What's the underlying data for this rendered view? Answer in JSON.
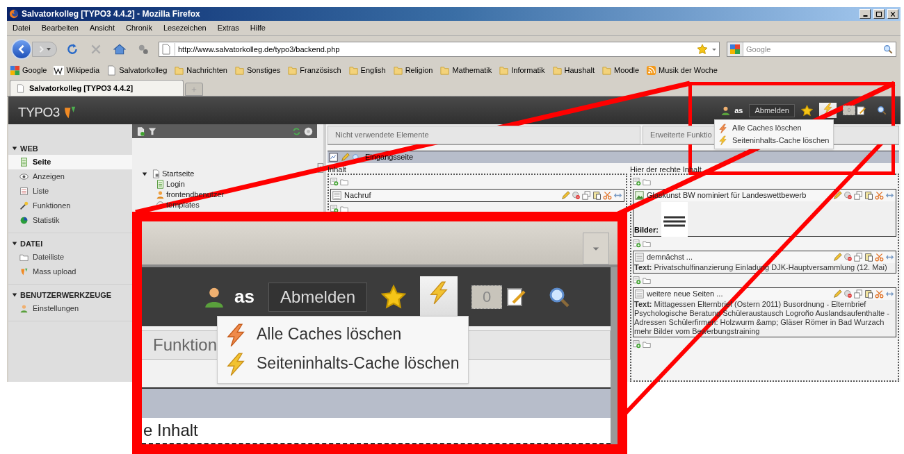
{
  "browser": {
    "title": "Salvatorkolleg [TYPO3 4.4.2] - Mozilla Firefox",
    "menu": [
      "Datei",
      "Bearbeiten",
      "Ansicht",
      "Chronik",
      "Lesezeichen",
      "Extras",
      "Hilfe"
    ],
    "url": "http://www.salvatorkolleg.de/typo3/backend.php",
    "search_placeholder": "Google",
    "bookmarks": [
      {
        "label": "Google",
        "kind": "google"
      },
      {
        "label": "Wikipedia",
        "kind": "wiki"
      },
      {
        "label": "Salvatorkolleg",
        "kind": "page"
      },
      {
        "label": "Nachrichten",
        "kind": "folder"
      },
      {
        "label": "Sonstiges",
        "kind": "folder"
      },
      {
        "label": "Französisch",
        "kind": "folder"
      },
      {
        "label": "English",
        "kind": "folder"
      },
      {
        "label": "Religion",
        "kind": "folder"
      },
      {
        "label": "Mathematik",
        "kind": "folder"
      },
      {
        "label": "Informatik",
        "kind": "folder"
      },
      {
        "label": "Haushalt",
        "kind": "folder"
      },
      {
        "label": "Moodle",
        "kind": "folder"
      },
      {
        "label": "Musik der Woche",
        "kind": "rss"
      }
    ],
    "tabs": [
      {
        "label": "Salvatorkolleg [TYPO3 4.4.2]",
        "selected": true
      }
    ]
  },
  "backend": {
    "logo": "TYPO3",
    "user": "as",
    "logout": "Abmelden",
    "badge": "0",
    "cache_menu_open": true,
    "cache_menu": [
      {
        "label": "Alle Caches löschen",
        "kind": "all"
      },
      {
        "label": "Seiteninhalts-Cache löschen",
        "kind": "page"
      }
    ],
    "modules": [
      {
        "heading": "WEB",
        "expanded": true,
        "items": [
          {
            "label": "Seite",
            "kind": "page",
            "selected": true
          },
          {
            "label": "Anzeigen",
            "kind": "eye",
            "selected": false
          },
          {
            "label": "Liste",
            "kind": "list",
            "selected": false
          },
          {
            "label": "Funktionen",
            "kind": "wand",
            "selected": false
          },
          {
            "label": "Statistik",
            "kind": "pie",
            "selected": false
          }
        ]
      },
      {
        "heading": "DATEI",
        "expanded": true,
        "items": [
          {
            "label": "Dateiliste",
            "kind": "folder",
            "selected": false
          },
          {
            "label": "Mass upload",
            "kind": "logo",
            "selected": false
          }
        ]
      },
      {
        "heading": "BENUTZERWERKZEUGE",
        "expanded": true,
        "items": [
          {
            "label": "Einstellungen",
            "kind": "user",
            "selected": false
          }
        ]
      }
    ],
    "page_tree": [
      {
        "label": "Startseite",
        "expanded": true,
        "kind": "root",
        "children": [
          {
            "label": "Login",
            "kind": "page"
          },
          {
            "label": "frontendbenutzer",
            "kind": "users"
          },
          {
            "label": "templates",
            "kind": "sysfolder"
          }
        ]
      }
    ],
    "content_tabs": [
      "Nicht verwendete Elemente",
      "Erweiterte Funktio"
    ],
    "page_title": "Eingangsseite",
    "columns": [
      {
        "title": "Inhalt",
        "elements": [
          {
            "kind": "text",
            "header": "Nachruf"
          }
        ]
      },
      {
        "title": "Hier der rechte Inhalt",
        "elements": [
          {
            "kind": "image",
            "header": "Glaskunst BW nominiert für Landeswettbewerb",
            "label": "Bilder:"
          },
          {
            "kind": "text",
            "header": "demnächst ...",
            "text": "**Text:** Privatschulfinanzierung Einladung DJK-Hauptversammlung (12. Mai)"
          },
          {
            "kind": "text",
            "header": "weitere neue Seiten ...",
            "text": "**Text:** Mittagessen Elternbrief (Ostern 2011) Busordnung - Elternbrief Psychologische Beratung Schüleraustausch Logroño Auslandsaufenthalte - Adressen Schülerfirmen: Holzwurm &amp; Gläser Römer in Bad Wurzach mehr Bilder vom Bewerbungstraining"
          }
        ]
      }
    ]
  },
  "inset": {
    "user": "as",
    "logout": "Abmelden",
    "badge": "0",
    "cache_menu_open": true,
    "cache_menu": [
      {
        "label": "Alle Caches löschen",
        "kind": "all"
      },
      {
        "label": "Seiteninhalts-Cache löschen",
        "kind": "page"
      }
    ],
    "tab_fragment": "Funktion",
    "column_fragment": "e Inhalt"
  }
}
